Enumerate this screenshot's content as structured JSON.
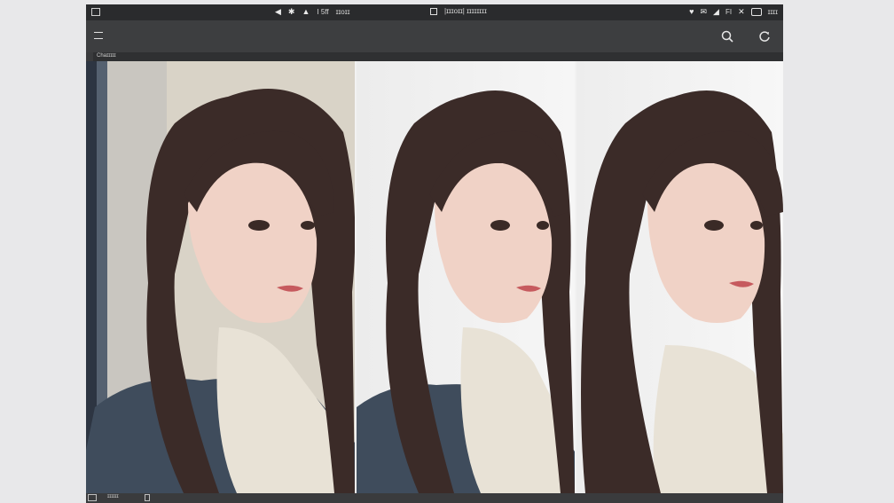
{
  "status_bar": {
    "left_text": "I 5ff",
    "left_text2": "ɪɪoɪɪ",
    "center_text": "|ɪɪɪoɪɪ| ɪɪɪɪɪɪɪɪ",
    "right_text": "FI",
    "time": "ɪɪɪɪ"
  },
  "tab": {
    "label": "Chaɪɪɪɪɪ"
  },
  "bottom": {
    "label": "ɪɪɪɪɪɪ"
  },
  "icons": {
    "menu": "menu-icon",
    "search": "search-icon",
    "refresh": "refresh-icon"
  },
  "colors": {
    "app_bar": "#3d3e40",
    "status_bar": "#2a2b2d",
    "hair": "#3b2b28",
    "sweater_light": "#e8e2d6",
    "sweater_dark": "#3f4c5c"
  }
}
